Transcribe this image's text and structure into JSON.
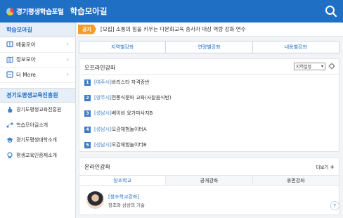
{
  "header": {
    "logo_text": "경기평생학습포털",
    "title": "학습모아길",
    "search_icon": "search-icon"
  },
  "sidebar": {
    "section1_title": "학습모아길",
    "items": [
      {
        "label": "배움모아",
        "icon": "book-icon"
      },
      {
        "label": "정보모아",
        "icon": "map-icon"
      },
      {
        "label": "더 More",
        "icon": "grid-icon"
      }
    ],
    "section2_title": "경기도평생교육진흥원",
    "links": [
      {
        "label": "경기도평생교육진흥원",
        "icon": "hand-icon"
      },
      {
        "label": "학습모아길소개",
        "icon": "path-icon"
      },
      {
        "label": "경기도평생대학소개",
        "icon": "graduation-icon"
      },
      {
        "label": "평생교육인증제소개",
        "icon": "certificate-icon"
      }
    ]
  },
  "notice": {
    "badge": "공지",
    "text": "[모집] 소통의 힘을 키우는 다문화교육 종사자 대상 역량 강화 연수"
  },
  "tabs": [
    "지역별강좌",
    "연령별강좌",
    "내용별강좌"
  ],
  "offline": {
    "title": "오프라인강좌",
    "region_select": "지역설정",
    "courses": [
      {
        "num": "1",
        "region": "[여주시]",
        "name": "바리스타 자격증반"
      },
      {
        "num": "2",
        "region": "[양주시]",
        "name": "전통식문화 교육(사찰음식반)"
      },
      {
        "num": "3",
        "region": "[성남시]",
        "name": "베이비 요가마사지B"
      },
      {
        "num": "4",
        "region": "[성남시]",
        "name": "오감체험놀이터A"
      },
      {
        "num": "5",
        "region": "[성남시]",
        "name": "오감체험놀이터B"
      }
    ]
  },
  "online": {
    "title": "온라인강좌",
    "more": "더보기",
    "tabs": [
      "창조학교",
      "공개강좌",
      "휴먼강좌"
    ],
    "course_title": "[창조학교강좌]",
    "course_sub": "창조와 상상의 기술"
  },
  "colors": {
    "header_blue": "#1f6fc5",
    "notice_orange": "#f39b2c",
    "number_blue": "#3e7cc6"
  }
}
